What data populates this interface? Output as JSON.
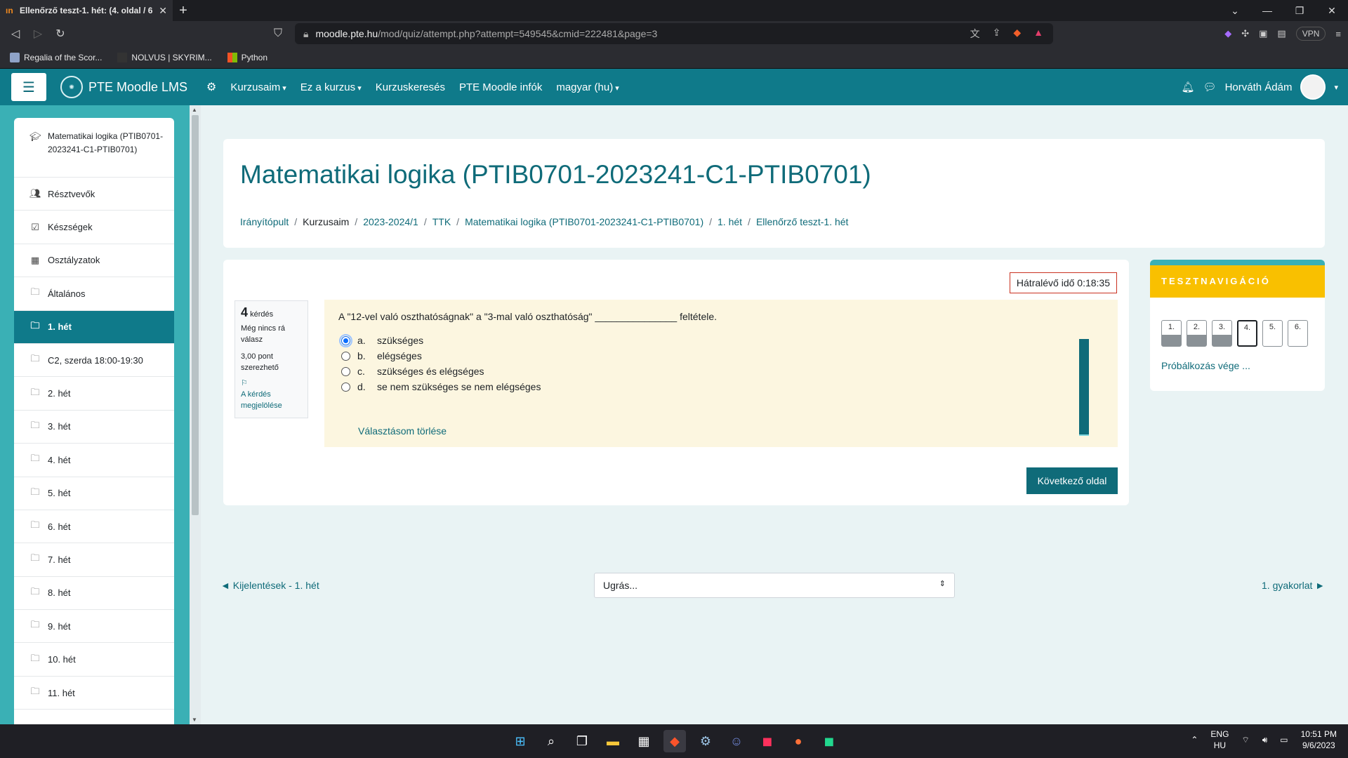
{
  "browser": {
    "tab_title": "Ellenőrző teszt-1. hét: (4. oldal / 6",
    "url_host": "moodle.pte.hu",
    "url_path": "/mod/quiz/attempt.php?attempt=549545&cmid=222481&page=3",
    "vpn_label": "VPN",
    "bookmarks": [
      "Regalia of the Scor...",
      "NOLVUS | SKYRIM...",
      "Python"
    ]
  },
  "navbar": {
    "brand": "PTE Moodle LMS",
    "menu": [
      "Kurzusaim",
      "Ez a kurzus",
      "Kurzuskeresés",
      "PTE Moodle infók",
      "magyar (hu)"
    ],
    "user_name": "Horváth Ádám"
  },
  "sidebar": {
    "course": "Matematikai logika (PTIB0701-2023241-C1-PTIB0701)",
    "items": [
      {
        "label": "Résztvevők",
        "icon": "users-icon"
      },
      {
        "label": "Készségek",
        "icon": "checkbox-icon"
      },
      {
        "label": "Osztályzatok",
        "icon": "table-icon"
      },
      {
        "label": "Általános",
        "icon": "folder-icon"
      },
      {
        "label": "1. hét",
        "icon": "folder-icon",
        "active": true
      },
      {
        "label": "C2, szerda 18:00-19:30",
        "icon": "folder-icon"
      },
      {
        "label": "2. hét",
        "icon": "folder-icon"
      },
      {
        "label": "3. hét",
        "icon": "folder-icon"
      },
      {
        "label": "4. hét",
        "icon": "folder-icon"
      },
      {
        "label": "5. hét",
        "icon": "folder-icon"
      },
      {
        "label": "6. hét",
        "icon": "folder-icon"
      },
      {
        "label": "7. hét",
        "icon": "folder-icon"
      },
      {
        "label": "8. hét",
        "icon": "folder-icon"
      },
      {
        "label": "9. hét",
        "icon": "folder-icon"
      },
      {
        "label": "10. hét",
        "icon": "folder-icon"
      },
      {
        "label": "11. hét",
        "icon": "folder-icon"
      }
    ]
  },
  "header": {
    "title": "Matematikai logika (PTIB0701-2023241-C1-PTIB0701)",
    "breadcrumb": [
      "Irányítópult",
      "Kurzusaim",
      "2023-2024/1",
      "TTK",
      "Matematikai logika (PTIB0701-2023241-C1-PTIB0701)",
      "1. hét",
      "Ellenőrző teszt-1. hét"
    ]
  },
  "question": {
    "timer": "Hátralévő idő 0:18:35",
    "number": "4",
    "number_suffix": "kérdés",
    "status": "Még nincs rá válasz",
    "points": "3,00 pont szerezhető",
    "flag_line1": "A kérdés",
    "flag_line2": "megjelölése",
    "text": "A \"12-vel való oszthatóságnak\" a \"3-mal való oszthatóság\" _______________ feltétele.",
    "options": [
      {
        "letter": "a.",
        "label": "szükséges",
        "selected": true
      },
      {
        "letter": "b.",
        "label": "elégséges",
        "selected": false
      },
      {
        "letter": "c.",
        "label": "szükséges és elégséges",
        "selected": false
      },
      {
        "letter": "d.",
        "label": "se nem szükséges se nem elégséges",
        "selected": false
      }
    ],
    "clear_label": "Választásom törlése",
    "next_label": "Következő oldal"
  },
  "quiz_nav": {
    "heading": "TESZTNAVIGÁCIÓ",
    "buttons": [
      {
        "label": "1.",
        "state": "answered"
      },
      {
        "label": "2.",
        "state": "answered"
      },
      {
        "label": "3.",
        "state": "answered"
      },
      {
        "label": "4.",
        "state": "current"
      },
      {
        "label": "5.",
        "state": "empty"
      },
      {
        "label": "6.",
        "state": "empty"
      }
    ],
    "finish_label": "Próbálkozás vége ..."
  },
  "footer_nav": {
    "prev_label": "◄ Kijelentések - 1. hét",
    "jump_placeholder": "Ugrás...",
    "next_label": "1. gyakorlat ►"
  },
  "taskbar": {
    "lang_top": "ENG",
    "lang_bottom": "HU",
    "time": "10:51 PM",
    "date": "9/6/2023"
  }
}
